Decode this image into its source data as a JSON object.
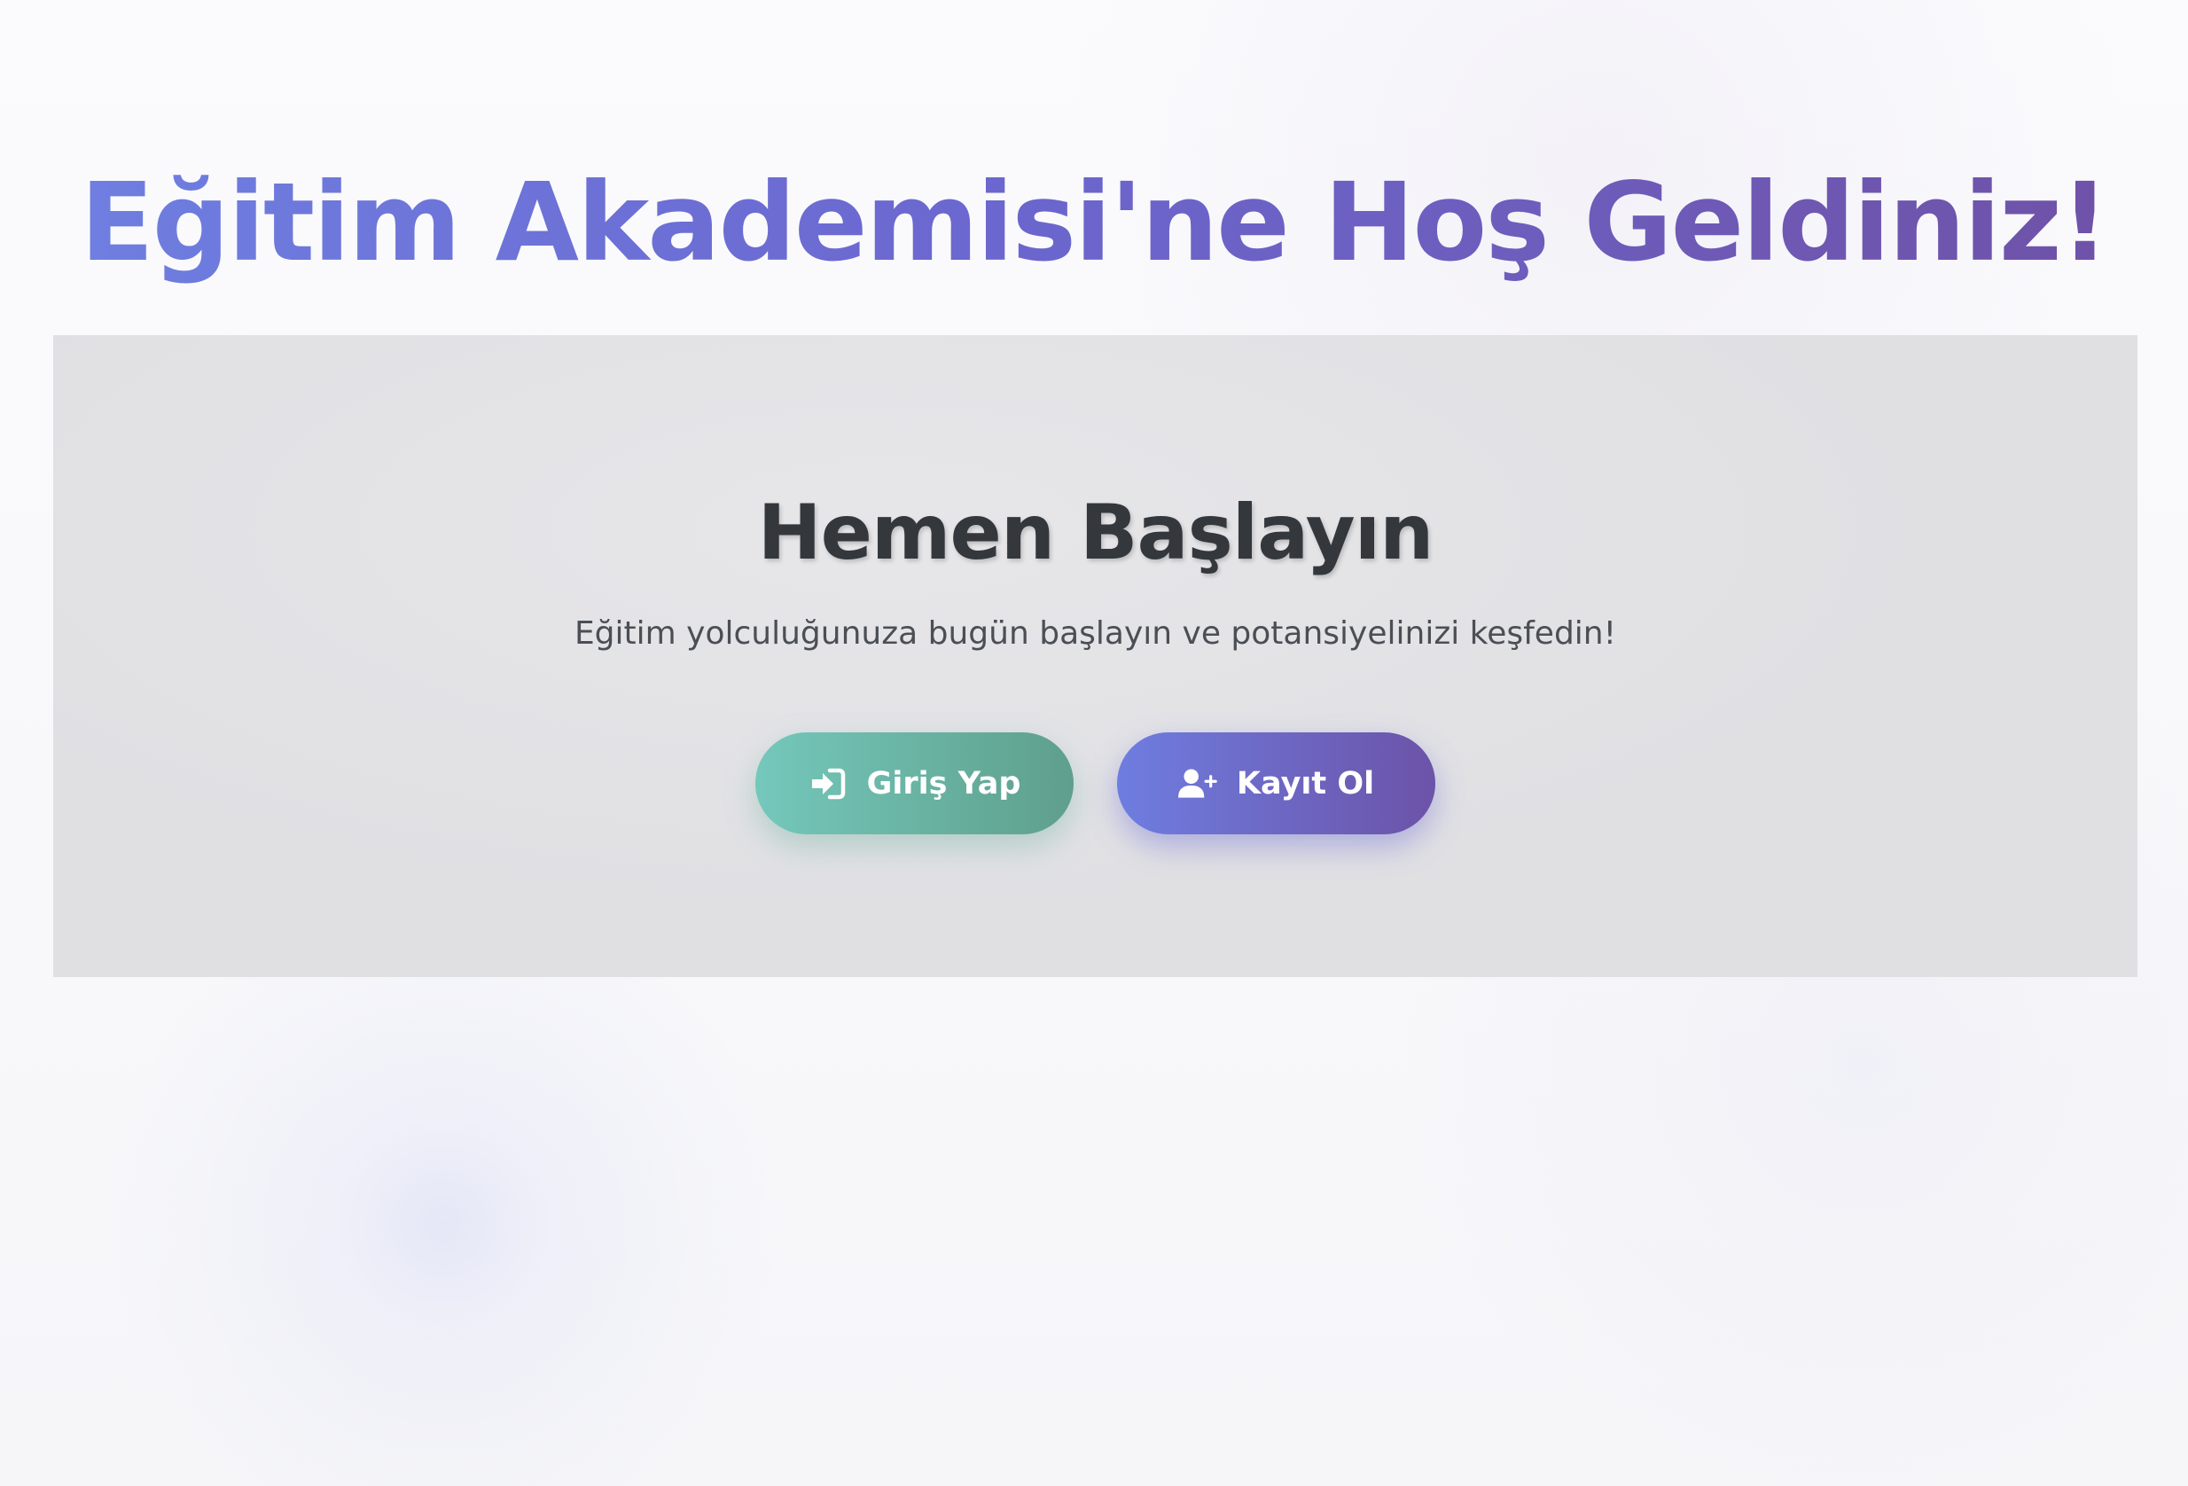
{
  "header": {
    "title": "Eğitim Akademisi'ne Hoş Geldiniz!"
  },
  "cta": {
    "title": "Hemen Başlayın",
    "subtitle": "Eğitim yolculuğunuza bugün başlayın ve potansiyelinizi keşfedin!",
    "login_label": "Giriş Yap",
    "login_icon": "sign-in-icon",
    "register_label": "Kayıt Ol",
    "register_icon": "user-plus-icon"
  },
  "colors": {
    "title_gradient_start": "#6f7ee0",
    "title_gradient_end": "#6f52a8",
    "login_gradient_start": "#74c8bb",
    "login_gradient_end": "#5f9f8c",
    "register_gradient_start": "#6e7de0",
    "register_gradient_end": "#6c53a8",
    "panel_background": "#e0e0e3",
    "heading_text": "#34383d"
  }
}
